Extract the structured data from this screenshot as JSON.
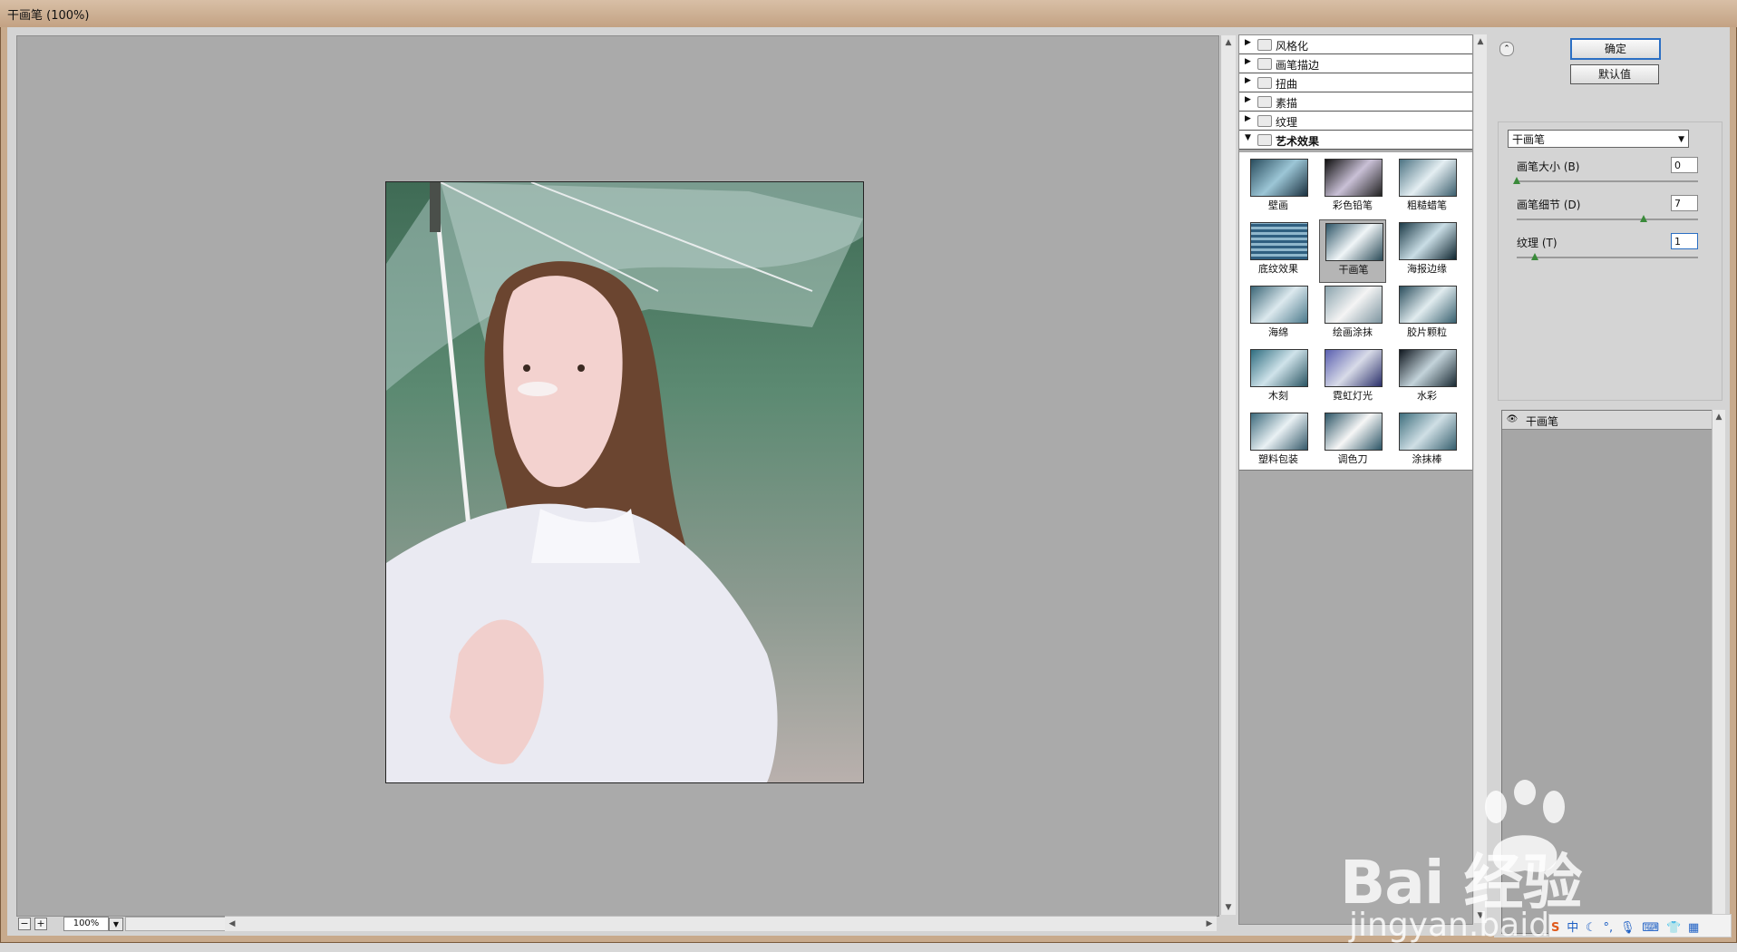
{
  "window": {
    "title": "干画笔 (100%)"
  },
  "preview": {
    "zoom": "100%"
  },
  "gallery": {
    "categories": [
      {
        "label": "风格化",
        "expanded": false
      },
      {
        "label": "画笔描边",
        "expanded": false
      },
      {
        "label": "扭曲",
        "expanded": false
      },
      {
        "label": "素描",
        "expanded": false
      },
      {
        "label": "纹理",
        "expanded": false
      },
      {
        "label": "艺术效果",
        "expanded": true
      }
    ],
    "filters": [
      "壁画",
      "彩色铅笔",
      "粗糙蜡笔",
      "底纹效果",
      "干画笔",
      "海报边缘",
      "海绵",
      "绘画涂抹",
      "胶片颗粒",
      "木刻",
      "霓虹灯光",
      "水彩",
      "塑料包装",
      "调色刀",
      "涂抹棒"
    ],
    "selected_filter": "干画笔"
  },
  "panel": {
    "ok_label": "确定",
    "default_label": "默认值",
    "filter_select": "干画笔",
    "params": {
      "brush_size": {
        "label": "画笔大小 (B)",
        "value": "0",
        "fraction": 0.0
      },
      "brush_detail": {
        "label": "画笔细节 (D)",
        "value": "7",
        "fraction": 0.7
      },
      "texture": {
        "label": "纹理 (T)",
        "value": "1",
        "fraction": 0.1
      }
    },
    "layer_name": "干画笔"
  },
  "watermark": {
    "brand": "Bai 经验",
    "url": "jingyan.baidu.com"
  },
  "tray": {
    "ime": "中"
  }
}
